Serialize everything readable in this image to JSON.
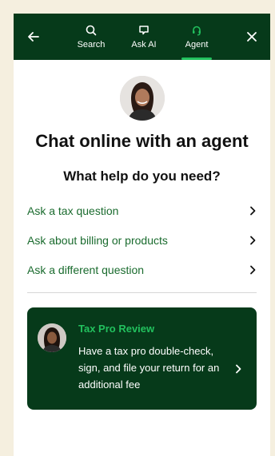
{
  "header": {
    "tabs": [
      {
        "label": "Search",
        "icon": "search-icon"
      },
      {
        "label": "Ask AI",
        "icon": "chat-bubble-icon"
      },
      {
        "label": "Agent",
        "icon": "headset-icon",
        "active": true
      }
    ]
  },
  "main": {
    "title": "Chat online with an agent",
    "subtitle": "What help do you need?",
    "options": [
      {
        "label": "Ask a tax question"
      },
      {
        "label": "Ask about billing or products"
      },
      {
        "label": "Ask a different question"
      }
    ]
  },
  "promo": {
    "title": "Tax Pro Review",
    "body": "Have a tax pro double-check, sign, and file your return for an additional fee"
  },
  "colors": {
    "header_bg": "#063a1a",
    "accent_green": "#22c15e",
    "link_green": "#1a6b2e",
    "page_bg": "#f5efdf"
  }
}
